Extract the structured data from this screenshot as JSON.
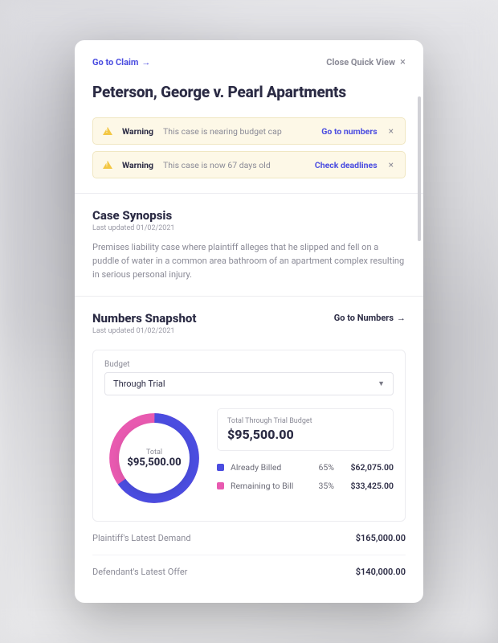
{
  "colors": {
    "primary": "#4b4de0",
    "pink": "#e85ab0",
    "warning": "#f3c744"
  },
  "topLinks": {
    "goToClaim": "Go to Claim",
    "closeQuickView": "Close Quick View"
  },
  "caseTitle": "Peterson, George v. Pearl Apartments",
  "alerts": [
    {
      "label": "Warning",
      "text": "This case is nearing budget cap",
      "link": "Go to numbers"
    },
    {
      "label": "Warning",
      "text": "This case is now 67 days old",
      "link": "Check deadlines"
    }
  ],
  "synopsis": {
    "title": "Case Synopsis",
    "updated": "Last updated 01/02/2021",
    "body": "Premises liability case where plaintiff alleges that he slipped and fell on a puddle of water in a common area bathroom of an apartment complex resulting in serious personal injury."
  },
  "numbers": {
    "title": "Numbers Snapshot",
    "updated": "Last updated 01/02/2021",
    "goLink": "Go to Numbers",
    "budgetLabel": "Budget",
    "selectValue": "Through Trial",
    "donut": {
      "centerLabel": "Total",
      "centerValue": "$95,500.00"
    },
    "totalBox": {
      "label": "Total Through Trial Budget",
      "value": "$95,500.00"
    },
    "legend": [
      {
        "swatch": "#4b4de0",
        "label": "Already Billed",
        "pct": "65%",
        "amount": "$62,075.00"
      },
      {
        "swatch": "#e85ab0",
        "label": "Remaining to Bill",
        "pct": "35%",
        "amount": "$33,425.00"
      }
    ],
    "rows": [
      {
        "label": "Plaintiff's Latest Demand",
        "value": "$165,000.00"
      },
      {
        "label": "Defendant's Latest Offer",
        "value": "$140,000.00"
      }
    ]
  },
  "chart_data": {
    "type": "pie",
    "title": "Total Through Trial Budget",
    "total": 95500.0,
    "series": [
      {
        "name": "Already Billed",
        "value": 62075.0,
        "pct": 65,
        "color": "#4b4de0"
      },
      {
        "name": "Remaining to Bill",
        "value": 33425.0,
        "pct": 35,
        "color": "#e85ab0"
      }
    ]
  }
}
